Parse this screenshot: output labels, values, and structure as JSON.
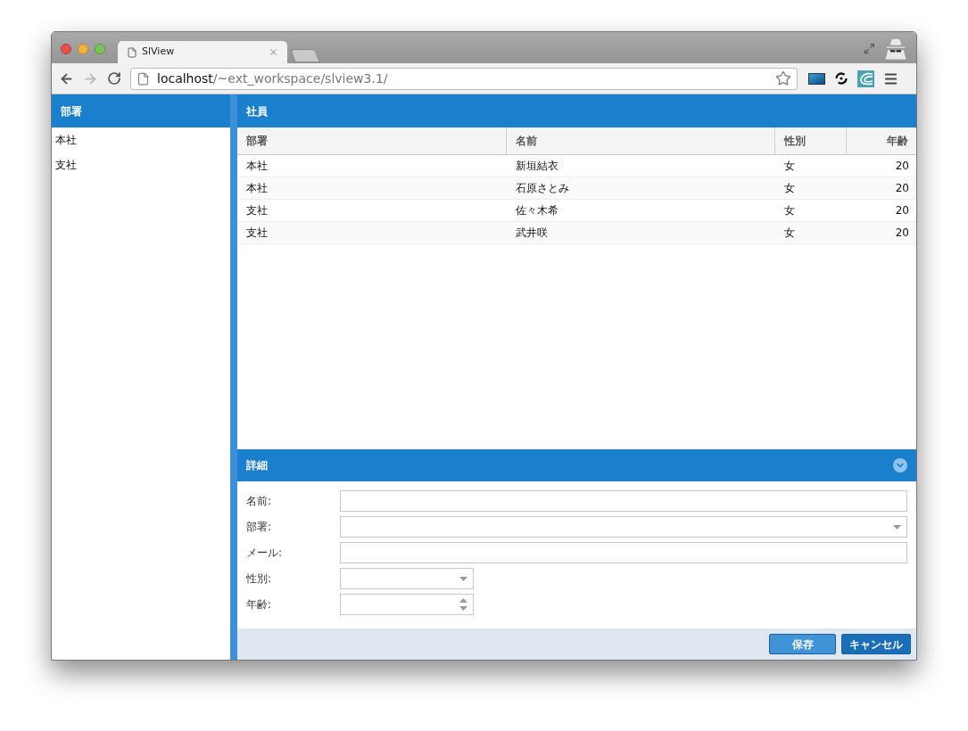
{
  "browser": {
    "tab": {
      "title": "SlView",
      "selected": true
    },
    "address": {
      "host": "localhost",
      "path": "/~ext_workspace/slview3.1/"
    }
  },
  "departments": {
    "title": "部署",
    "items": [
      {
        "label": "本社",
        "selected": false
      },
      {
        "label": "支社",
        "selected": false
      }
    ]
  },
  "employees": {
    "title": "社員",
    "columns": [
      {
        "label": "部署",
        "kind": "text"
      },
      {
        "label": "名前",
        "kind": "text"
      },
      {
        "label": "性別",
        "kind": "text"
      },
      {
        "label": "年齢",
        "kind": "number"
      }
    ],
    "rows": [
      [
        "本社",
        "新垣結衣",
        "女",
        "20"
      ],
      [
        "本社",
        "石原さとみ",
        "女",
        "20"
      ],
      [
        "支社",
        "佐々木希",
        "女",
        "20"
      ],
      [
        "支社",
        "武井咲",
        "女",
        "20"
      ]
    ]
  },
  "detail": {
    "title": "詳細",
    "expanded": true,
    "fields": [
      {
        "label": "名前:",
        "kind": "text"
      },
      {
        "label": "部署:",
        "kind": "combo"
      },
      {
        "label": "メール:",
        "kind": "text"
      },
      {
        "label": "性別:",
        "kind": "short-combo"
      },
      {
        "label": "年齢:",
        "kind": "number"
      }
    ],
    "buttons": [
      {
        "label": "保存",
        "color": "#3f93d6"
      },
      {
        "label": "キャンセル",
        "color": "#1b6fb8"
      }
    ]
  }
}
